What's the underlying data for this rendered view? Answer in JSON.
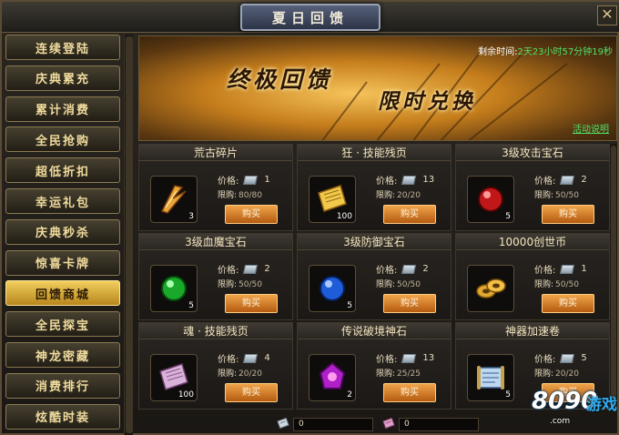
{
  "window": {
    "title": "夏日回馈",
    "close_glyph": "✕"
  },
  "sidebar": {
    "items": [
      {
        "label": "连续登陆",
        "active": false
      },
      {
        "label": "庆典累充",
        "active": false
      },
      {
        "label": "累计消费",
        "active": false
      },
      {
        "label": "全民抢购",
        "active": false
      },
      {
        "label": "超低折扣",
        "active": false
      },
      {
        "label": "幸运礼包",
        "active": false
      },
      {
        "label": "庆典秒杀",
        "active": false
      },
      {
        "label": "惊喜卡牌",
        "active": false
      },
      {
        "label": "回馈商城",
        "active": true
      },
      {
        "label": "全民探宝",
        "active": false
      },
      {
        "label": "神龙密藏",
        "active": false
      },
      {
        "label": "消费排行",
        "active": false
      },
      {
        "label": "炫酷时装",
        "active": false
      }
    ]
  },
  "banner": {
    "title_part1": "终极回馈",
    "title_part2": "限时兑换",
    "timer_label": "剩余时间:",
    "timer_value": "2天23小时57分钟19秒",
    "help_link": "活动说明"
  },
  "shop": {
    "price_label": "价格:",
    "limit_label": "限购:",
    "buy_label": "购买",
    "items": [
      {
        "name": "荒古碎片",
        "count": "3",
        "price": "1",
        "limit": "80/80",
        "icon": "shard-icon"
      },
      {
        "name": "狂 · 技能残页",
        "count": "100",
        "price": "13",
        "limit": "20/20",
        "icon": "golden-scroll-icon"
      },
      {
        "name": "3级攻击宝石",
        "count": "5",
        "price": "2",
        "limit": "50/50",
        "icon": "red-gem-icon"
      },
      {
        "name": "3级血魔宝石",
        "count": "5",
        "price": "2",
        "limit": "50/50",
        "icon": "green-gem-icon"
      },
      {
        "name": "3级防御宝石",
        "count": "5",
        "price": "2",
        "limit": "50/50",
        "icon": "blue-gem-icon"
      },
      {
        "name": "10000创世币",
        "count": "",
        "price": "1",
        "limit": "50/50",
        "icon": "gold-coins-icon"
      },
      {
        "name": "魂 · 技能残页",
        "count": "100",
        "price": "4",
        "limit": "20/20",
        "icon": "purple-scroll-icon"
      },
      {
        "name": "传说破境神石",
        "count": "2",
        "price": "13",
        "limit": "25/25",
        "icon": "purple-stone-icon"
      },
      {
        "name": "神器加速卷",
        "count": "5",
        "price": "5",
        "limit": "20/20",
        "icon": "blueprint-scroll-icon"
      }
    ]
  },
  "footer": {
    "currency1_value": "0",
    "currency2_value": "0"
  },
  "watermark": {
    "number": "8090",
    "game": "游戏",
    "domain": ".com"
  },
  "colors": {
    "accent_gold": "#f1cf5e",
    "timer_green": "#4ee36a",
    "buy_button": "#d8802c"
  }
}
